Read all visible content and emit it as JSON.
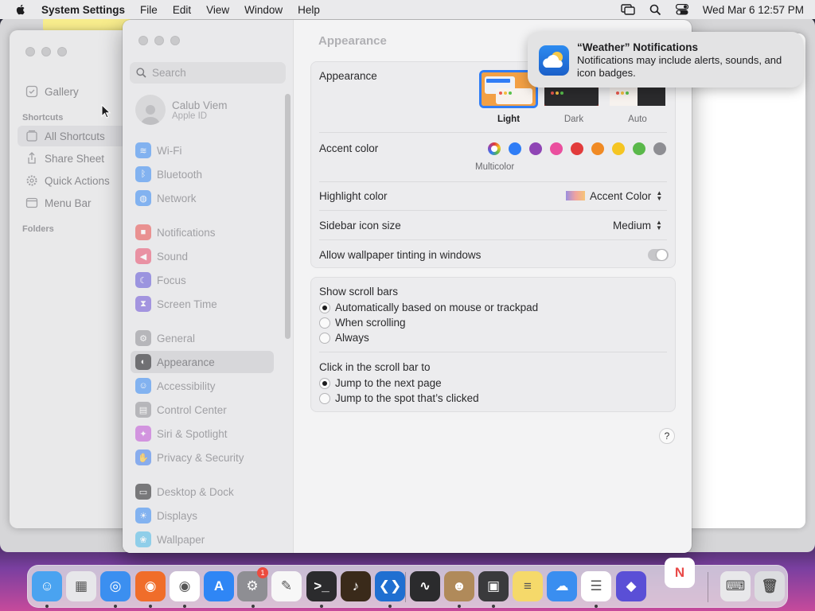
{
  "menubar": {
    "app_name": "System Settings",
    "menus": [
      "File",
      "Edit",
      "View",
      "Window",
      "Help"
    ],
    "clock": "Wed Mar 6  12:57 PM",
    "icons": [
      "apple-icon",
      "screen-mirroring-icon",
      "spotlight-search-icon",
      "control-center-icon"
    ]
  },
  "shortcuts_window": {
    "gallery": "Gallery",
    "section_shortcuts": "Shortcuts",
    "items": [
      "All Shortcuts",
      "Share Sheet",
      "Quick Actions",
      "Menu Bar"
    ],
    "selected": "All Shortcuts",
    "section_folders": "Folders"
  },
  "settings": {
    "search_placeholder": "Search",
    "profile": {
      "name": "Calub Viem",
      "subtitle": "Apple ID"
    },
    "sidebar_items": [
      {
        "label": "Wi-Fi",
        "icon": "wifi-icon",
        "color": "#2f86f5"
      },
      {
        "label": "Bluetooth",
        "icon": "bluetooth-icon",
        "color": "#2f86f5"
      },
      {
        "label": "Network",
        "icon": "network-icon",
        "color": "#2f86f5"
      },
      {
        "label": "Notifications",
        "icon": "notifications-icon",
        "color": "#e94a48"
      },
      {
        "label": "Sound",
        "icon": "sound-icon",
        "color": "#e94a6a"
      },
      {
        "label": "Focus",
        "icon": "focus-icon",
        "color": "#5c4fd6"
      },
      {
        "label": "Screen Time",
        "icon": "screen-time-icon",
        "color": "#6a4fd6"
      },
      {
        "label": "General",
        "icon": "gear-icon",
        "color": "#8e8e93"
      },
      {
        "label": "Appearance",
        "icon": "appearance-icon",
        "color": "#1d1d1f"
      },
      {
        "label": "Accessibility",
        "icon": "accessibility-icon",
        "color": "#2f86f5"
      },
      {
        "label": "Control Center",
        "icon": "control-center-icon",
        "color": "#8e8e93"
      },
      {
        "label": "Siri & Spotlight",
        "icon": "siri-icon",
        "color": "#c04fd6"
      },
      {
        "label": "Privacy & Security",
        "icon": "hand-icon",
        "color": "#3a7cf0"
      },
      {
        "label": "Desktop & Dock",
        "icon": "desktop-dock-icon",
        "color": "#1d1d1f"
      },
      {
        "label": "Displays",
        "icon": "displays-icon",
        "color": "#2f86f5"
      },
      {
        "label": "Wallpaper",
        "icon": "wallpaper-icon",
        "color": "#45b8e8"
      }
    ],
    "selected": "Appearance",
    "page_title": "Appearance",
    "appearance": {
      "label": "Appearance",
      "options": [
        "Light",
        "Dark",
        "Auto"
      ],
      "selected": "Light"
    },
    "accent": {
      "label": "Accent color",
      "caption": "Multicolor",
      "colors": [
        "#2f7df6",
        "#8f45b5",
        "#ea4f9e",
        "#e23b3b",
        "#f08a24",
        "#f5c522",
        "#5ab84a",
        "#8e8e93"
      ]
    },
    "highlight": {
      "label": "Highlight color",
      "value": "Accent Color"
    },
    "sidebar_icon_size": {
      "label": "Sidebar icon size",
      "value": "Medium"
    },
    "wallpaper_tinting": {
      "label": "Allow wallpaper tinting in windows",
      "enabled": true
    },
    "scroll_bars": {
      "label": "Show scroll bars",
      "options": [
        "Automatically based on mouse or trackpad",
        "When scrolling",
        "Always"
      ],
      "selected": "Automatically based on mouse or trackpad"
    },
    "click_scroll": {
      "label": "Click in the scroll bar to",
      "options": [
        "Jump to the next page",
        "Jump to the spot that’s clicked"
      ],
      "selected": "Jump to the next page"
    },
    "help": "?"
  },
  "notification": {
    "title": "“Weather” Notifications",
    "body": "Notifications may include alerts, sounds, and icon badges."
  },
  "dock": {
    "apps": [
      "Finder",
      "Launchpad",
      "Safari",
      "Firefox",
      "Chrome",
      "App Store",
      "System Settings",
      "TextEdit",
      "Terminal",
      "GarageBand",
      "VS Code",
      "Voice Memos",
      "Contacts",
      "Photo Booth",
      "Notes",
      "Weather",
      "Reminders",
      "Shortcuts",
      "News",
      "Keyboard Viewer",
      "Trash"
    ],
    "settings_badge": "1"
  }
}
